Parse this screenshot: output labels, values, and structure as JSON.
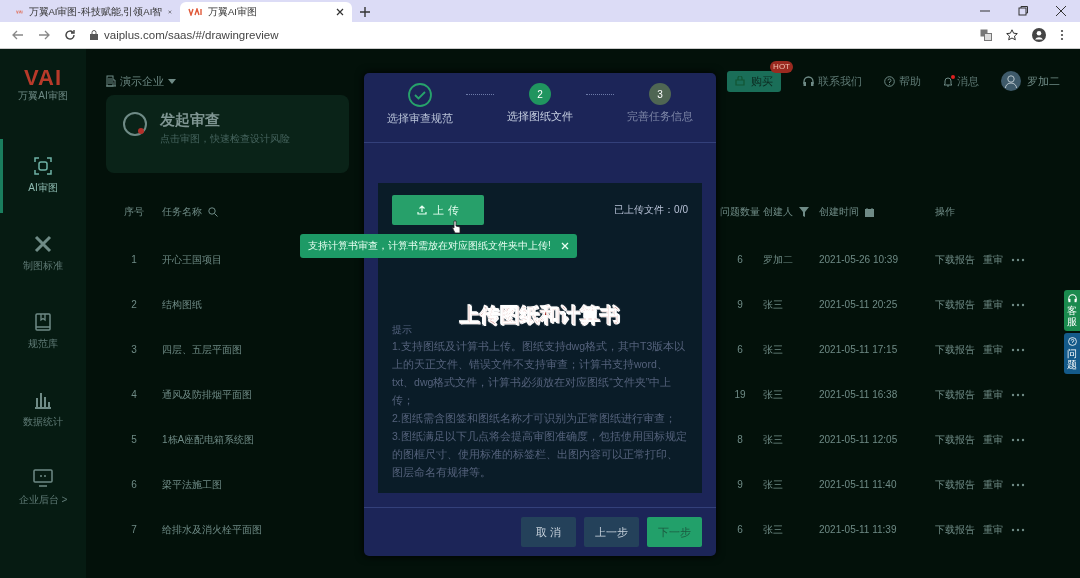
{
  "browser": {
    "tabs": [
      {
        "title": "万翼AI审图-科技赋能,引领AI智",
        "selected": false
      },
      {
        "title": "万翼AI审图",
        "selected": true
      }
    ],
    "url": "vaiplus.com/saas/#/drawingreview"
  },
  "sidebar": {
    "logo": {
      "mark": "VAI",
      "name": "万翼AI审图"
    },
    "items": [
      {
        "label": "AI审图",
        "kind": "scan",
        "selected": true
      },
      {
        "label": "制图标准",
        "kind": "tools",
        "selected": false
      },
      {
        "label": "规范库",
        "kind": "book",
        "selected": false
      },
      {
        "label": "数据统计",
        "kind": "chart",
        "selected": false
      },
      {
        "label": "企业后台 >",
        "kind": "monitor",
        "selected": false
      }
    ]
  },
  "header": {
    "company": "演示企业",
    "buy": {
      "label": "购买",
      "badge": "HOT"
    },
    "links": [
      {
        "kind": "contact",
        "label": "联系我们"
      },
      {
        "kind": "help",
        "label": "帮助"
      },
      {
        "kind": "message",
        "label": "消息",
        "unread": true
      }
    ],
    "user": "罗加二"
  },
  "launch_card": {
    "title": "发起审查",
    "subtitle": "点击审图，快速检查设计风险"
  },
  "table": {
    "columns": [
      {
        "label": "序号"
      },
      {
        "label": "任务名称"
      },
      {
        "label": "问题数量"
      },
      {
        "label": "创建人"
      },
      {
        "label": "创建时间"
      },
      {
        "label": "操作"
      }
    ],
    "rows": [
      {
        "index": "1",
        "name": "开心王国项目",
        "issues": "6",
        "creator": "罗加二",
        "created": "2021-05-26 10:39",
        "actions": [
          "下载报告",
          "重审"
        ]
      },
      {
        "index": "2",
        "name": "结构图纸",
        "issues": "9",
        "creator": "张三",
        "created": "2021-05-11 20:25",
        "actions": [
          "下载报告",
          "重审"
        ]
      },
      {
        "index": "3",
        "name": "四层、五层平面图",
        "issues": "6",
        "creator": "张三",
        "created": "2021-05-11 17:15",
        "actions": [
          "下载报告",
          "重审"
        ]
      },
      {
        "index": "4",
        "name": "通风及防排烟平面图",
        "issues": "19",
        "creator": "张三",
        "created": "2021-05-11 16:38",
        "actions": [
          "下载报告",
          "重审"
        ]
      },
      {
        "index": "5",
        "name": "1栋A座配电箱系统图",
        "issues": "8",
        "creator": "张三",
        "created": "2021-05-11 12:05",
        "actions": [
          "下载报告",
          "重审"
        ]
      },
      {
        "index": "6",
        "name": "梁平法施工图",
        "issues": "9",
        "creator": "张三",
        "created": "2021-05-11 11:40",
        "actions": [
          "下载报告",
          "重审"
        ]
      },
      {
        "index": "7",
        "name": "给排水及消火栓平面图",
        "issues": "6",
        "creator": "张三",
        "created": "2021-05-11 11:39",
        "actions": [
          "下载报告",
          "重审"
        ]
      }
    ]
  },
  "modal": {
    "steps": [
      {
        "label": "选择审查规范",
        "done": true,
        "selected": false
      },
      {
        "number": "2",
        "label": "选择图纸文件",
        "done": false,
        "selected": true
      },
      {
        "number": "3",
        "label": "完善任务信息",
        "done": false,
        "selected": false
      }
    ],
    "upload_button": "上 传",
    "uploaded": "已上传文件：0/0",
    "tooltip": "支持计算书审查，计算书需放在对应图纸文件夹中上传!",
    "caption": "上传图纸和计算书",
    "hint_title": "提示",
    "hints": [
      "1.支持图纸及计算书上传。图纸支持dwg格式，其中T3版本以上的天正文件、错误文件不支持审查；计算书支持word、txt、dwg格式文件，计算书必须放在对应图纸“文件夹”中上传；",
      "2.图纸需含图签和图纸名称才可识别为正常图纸进行审查；",
      "3.图纸满足以下几点将会提高审图准确度，包括使用国标规定的图框尺寸、使用标准的标签栏、出图内容可以正常打印、图层命名有规律等。"
    ],
    "buttons": [
      {
        "label": "取 消",
        "kind": "plain"
      },
      {
        "label": "上一步",
        "kind": "plain"
      },
      {
        "label": "下一步",
        "kind": "primary"
      }
    ]
  },
  "float_tabs": [
    {
      "label": "客服",
      "kind": "headset"
    },
    {
      "label": "问题",
      "kind": "help"
    }
  ]
}
